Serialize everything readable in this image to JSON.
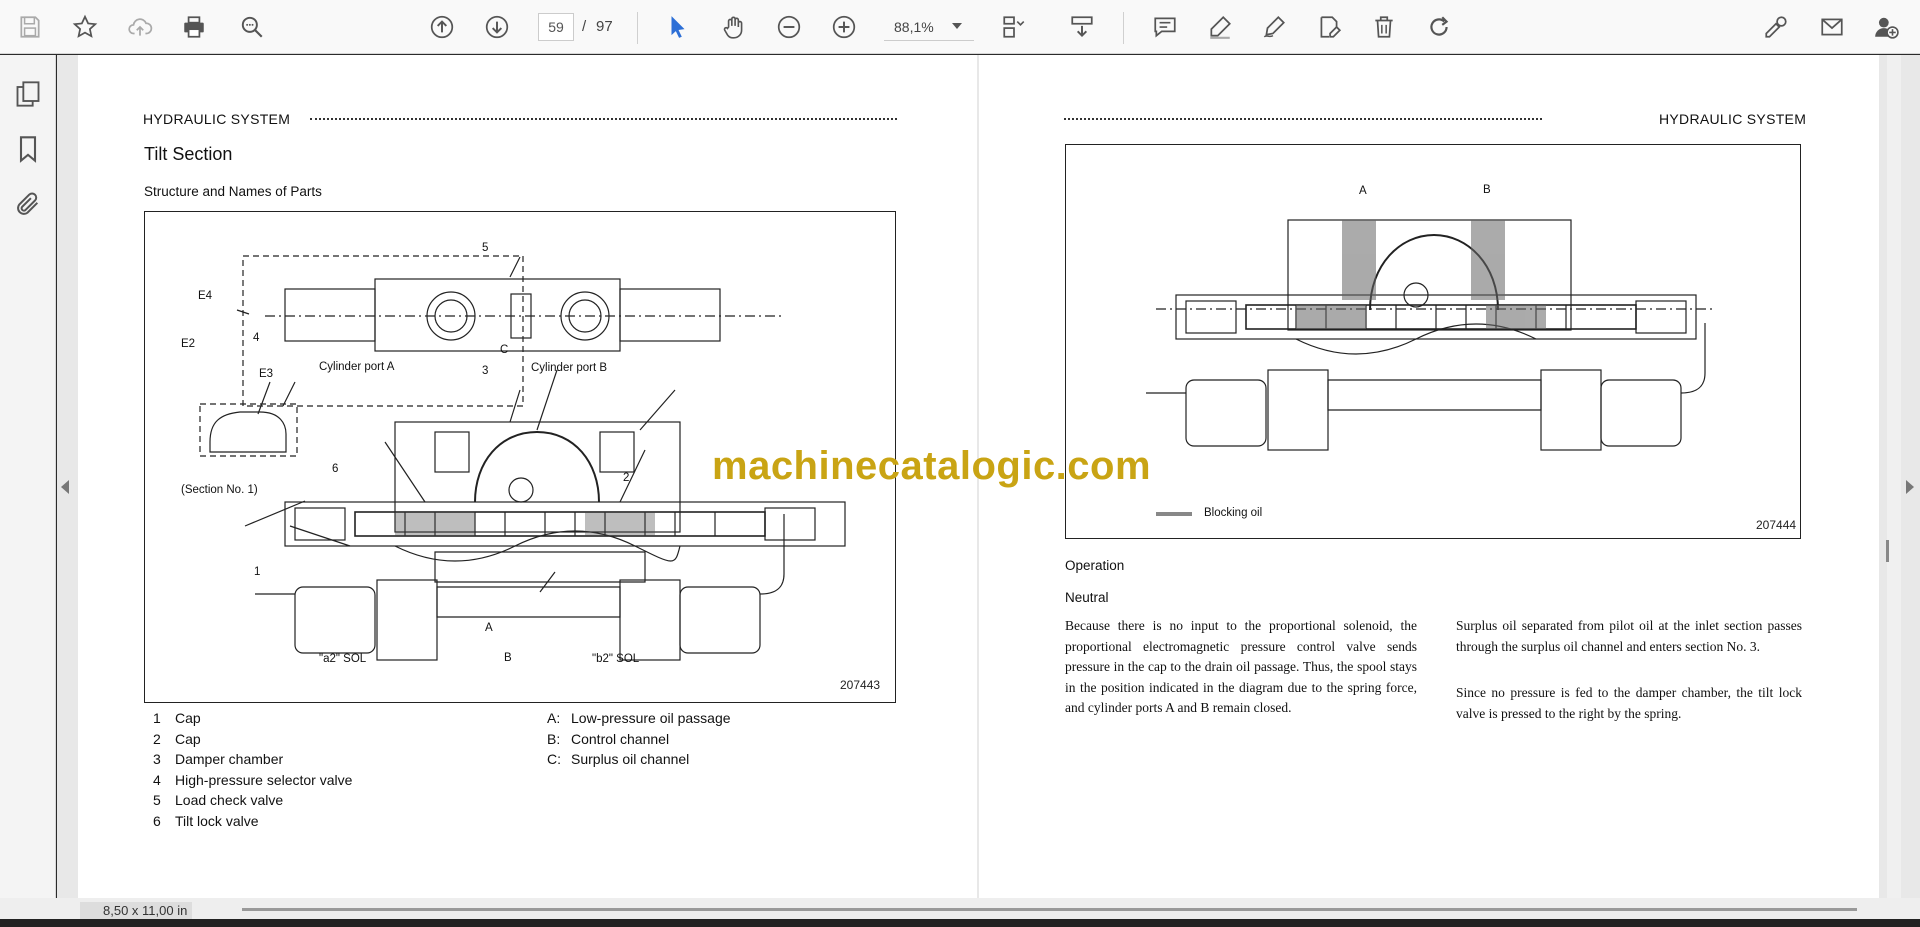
{
  "toolbar": {
    "current_page": "59",
    "page_separator": "/",
    "total_pages": "97",
    "zoom": "88,1%"
  },
  "status": {
    "page_size": "8,50 x 11,00 in"
  },
  "watermark": "machinecatalogic.com",
  "left_page": {
    "header": "HYDRAULIC SYSTEM",
    "section_title": "Tilt Section",
    "subsection_title": "Structure and Names of Parts",
    "figure_number": "207443",
    "figure_labels": {
      "e4": "E4",
      "e2": "E2",
      "e3": "E3",
      "n5": "5",
      "n4": "4",
      "cyl_a": "Cylinder port A",
      "n3": "3",
      "c": "C",
      "cyl_b": "Cylinder port B",
      "n6": "6",
      "section_no": "(Section No. 1)",
      "n2": "2",
      "n1": "1",
      "a": "A",
      "b": "B",
      "a2_sol": "\"a2\" SOL",
      "b2_sol": "\"b2\" SOL"
    },
    "parts": [
      {
        "num": "1",
        "name": "Cap"
      },
      {
        "num": "2",
        "name": "Cap"
      },
      {
        "num": "3",
        "name": "Damper chamber"
      },
      {
        "num": "4",
        "name": "High-pressure selector valve"
      },
      {
        "num": "5",
        "name": "Load check valve"
      },
      {
        "num": "6",
        "name": "Tilt lock valve"
      }
    ],
    "passages": [
      {
        "key": "A:",
        "name": "Low-pressure oil passage"
      },
      {
        "key": "B:",
        "name": "Control channel"
      },
      {
        "key": "C:",
        "name": "Surplus oil channel"
      }
    ]
  },
  "right_page": {
    "header": "HYDRAULIC SYSTEM",
    "figure_number": "207444",
    "figure_labels": {
      "a": "A",
      "b": "B",
      "blocking_oil": "Blocking oil"
    },
    "operation_title": "Operation",
    "neutral_title": "Neutral",
    "para_left": "Because there is no input to the proportional solenoid, the proportional electromagnetic pressure control valve sends pressure in the cap to the drain oil passage. Thus, the spool stays in the position indicated in the diagram due to the spring force, and cylinder ports A and B remain closed.",
    "para_right_1": "Surplus oil separated from pilot oil at the inlet section passes through the surplus oil channel and enters section No. 3.",
    "para_right_2": "Since no pressure is fed to the damper chamber, the tilt lock valve is pressed to the right by the spring."
  }
}
